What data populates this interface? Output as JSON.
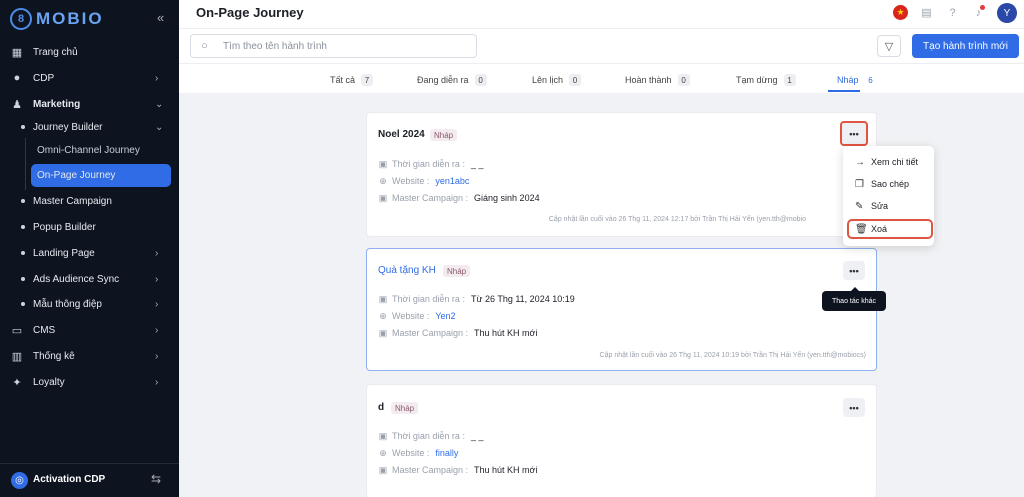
{
  "brand": {
    "logo_text": "MOBIO",
    "accent": "#2f6ce5",
    "sidebar_bg": "#0d1420"
  },
  "sidebar": {
    "items": [
      {
        "label": "Trang chủ",
        "icon": "grid-icon"
      },
      {
        "label": "CDP",
        "icon": "user-icon"
      },
      {
        "label": "Marketing",
        "icon": "people-icon"
      },
      {
        "label": "Journey Builder"
      },
      {
        "label": "Omni-Channel Journey"
      },
      {
        "label": "On-Page Journey"
      },
      {
        "label": "Master Campaign"
      },
      {
        "label": "Popup Builder"
      },
      {
        "label": "Landing Page"
      },
      {
        "label": "Ads Audience Sync"
      },
      {
        "label": "Mẫu thông điệp"
      },
      {
        "label": "CMS",
        "icon": "monitor-icon"
      },
      {
        "label": "Thống kê",
        "icon": "chart-icon"
      },
      {
        "label": "Loyalty",
        "icon": "star-icon"
      }
    ],
    "active": "On-Page Journey",
    "bottom_label": "Activation CDP"
  },
  "header": {
    "title": "On-Page Journey",
    "avatar": "Y"
  },
  "toolbar": {
    "search_placeholder": "Tìm theo tên hành trình",
    "create_label": "Tạo hành trình mới"
  },
  "tabs": [
    {
      "label": "Tất cả",
      "count": "7"
    },
    {
      "label": "Đang diễn ra",
      "count": "0"
    },
    {
      "label": "Lên lịch",
      "count": "0"
    },
    {
      "label": "Hoàn thành",
      "count": "0"
    },
    {
      "label": "Tạm dừng",
      "count": "1"
    },
    {
      "label": "Nháp",
      "count": "6"
    }
  ],
  "labels": {
    "time": "Thời gian diễn ra :",
    "website": "Website :",
    "master": "Master Campaign :"
  },
  "cards": [
    {
      "name": "Noel 2024",
      "status": "Nháp",
      "time": "_ _",
      "website": "yen1abc",
      "master": "Giáng sinh 2024",
      "updated": "Cập nhật lần cuối vào 26 Thg 11, 2024 12:17 bởi Trần Thị Hải Yến (yen.tth@mobio"
    },
    {
      "name": "Quà tặng KH",
      "status": "Nháp",
      "time": "Từ 26 Thg 11, 2024 10:19",
      "website": "Yen2",
      "master": "Thu hút KH mới",
      "updated": "Cập nhật lần cuối vào 26 Thg 11, 2024 10:19 bởi Trần Thị Hải Yến (yen.tth@mobiocs)"
    },
    {
      "name": "d",
      "status": "Nháp",
      "time": "_ _",
      "website": "finally",
      "master": "Thu hút KH mới"
    }
  ],
  "dropdown": [
    {
      "label": "Xem chi tiết",
      "icon": "arrow-right-icon"
    },
    {
      "label": "Sao chép",
      "icon": "copy-icon"
    },
    {
      "label": "Sửa",
      "icon": "edit-icon"
    },
    {
      "label": "Xoá",
      "icon": "trash-icon"
    }
  ],
  "tooltip": "Thao tác khác"
}
